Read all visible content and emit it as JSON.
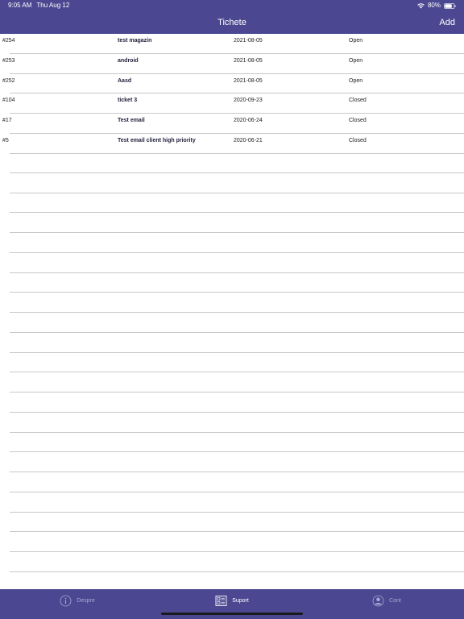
{
  "status_bar": {
    "time": "9:05 AM",
    "date": "Thu Aug 12",
    "battery": "80%"
  },
  "nav": {
    "title": "Tichete",
    "add_label": "Add"
  },
  "tickets": [
    {
      "id": "#254",
      "subject": "test magazin",
      "date": "2021-08-05",
      "status": "Open"
    },
    {
      "id": "#253",
      "subject": "android",
      "date": "2021-08-05",
      "status": "Open"
    },
    {
      "id": "#252",
      "subject": "Aasd",
      "date": "2021-08-05",
      "status": "Open"
    },
    {
      "id": "#104",
      "subject": "ticket 3",
      "date": "2020-09-23",
      "status": "Closed"
    },
    {
      "id": "#17",
      "subject": "Test email",
      "date": "2020-06-24",
      "status": "Closed"
    },
    {
      "id": "#5",
      "subject": "Test email client high priority",
      "date": "2020-06-21",
      "status": "Closed"
    }
  ],
  "tabbar": {
    "items": [
      {
        "label": "Despre",
        "icon": "info-icon",
        "active": false
      },
      {
        "label": "Suport",
        "icon": "support-list-icon",
        "active": true
      },
      {
        "label": "Cont",
        "icon": "account-icon",
        "active": false
      }
    ]
  },
  "colors": {
    "bar_background": "#4b4891",
    "tab_inactive": "#a9a7d6",
    "separator": "#c8c8c8"
  }
}
